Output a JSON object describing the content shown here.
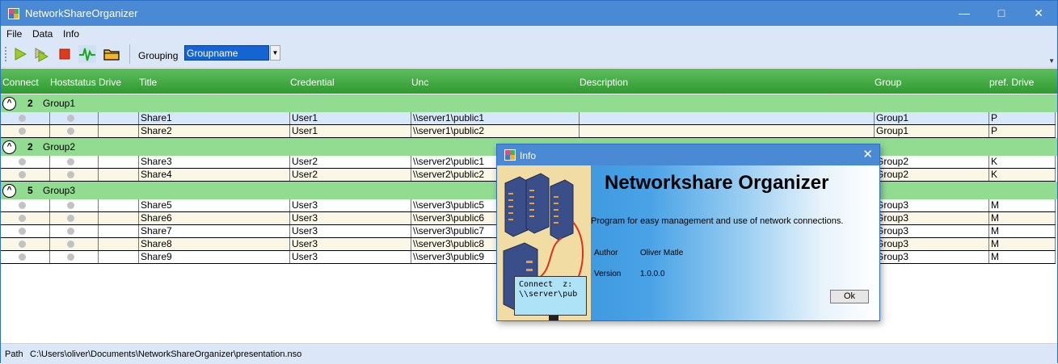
{
  "window": {
    "title": "NetworkShareOrganizer"
  },
  "menu": [
    "File",
    "Data",
    "Info"
  ],
  "toolbar": {
    "grouping_label": "Grouping",
    "grouping_value": "Groupname"
  },
  "columns": [
    "Connect",
    "Hoststatus",
    "Drive",
    "Title",
    "Credential",
    "Unc",
    "Description",
    "Group",
    "pref. Drive"
  ],
  "groups": [
    {
      "count": "2",
      "name": "Group1",
      "rows": [
        {
          "title": "Share1",
          "credential": "User1",
          "unc": "\\\\server1\\public1",
          "description": "",
          "group": "Group1",
          "pref_drive": "P"
        },
        {
          "title": "Share2",
          "credential": "User1",
          "unc": "\\\\server1\\public2",
          "description": "",
          "group": "Group1",
          "pref_drive": "P"
        }
      ]
    },
    {
      "count": "2",
      "name": "Group2",
      "rows": [
        {
          "title": "Share3",
          "credential": "User2",
          "unc": "\\\\server2\\public1",
          "description": "",
          "group": "Group2",
          "pref_drive": "K"
        },
        {
          "title": "Share4",
          "credential": "User2",
          "unc": "\\\\server2\\public2",
          "description": "",
          "group": "Group2",
          "pref_drive": "K"
        }
      ]
    },
    {
      "count": "5",
      "name": "Group3",
      "rows": [
        {
          "title": "Share5",
          "credential": "User3",
          "unc": "\\\\server3\\public5",
          "description": "",
          "group": "Group3",
          "pref_drive": "M"
        },
        {
          "title": "Share6",
          "credential": "User3",
          "unc": "\\\\server3\\public6",
          "description": "",
          "group": "Group3",
          "pref_drive": "M"
        },
        {
          "title": "Share7",
          "credential": "User3",
          "unc": "\\\\server3\\public7",
          "description": "",
          "group": "Group3",
          "pref_drive": "M"
        },
        {
          "title": "Share8",
          "credential": "User3",
          "unc": "\\\\server3\\public8",
          "description": "",
          "group": "Group3",
          "pref_drive": "M"
        },
        {
          "title": "Share9",
          "credential": "User3",
          "unc": "\\\\server3\\public9",
          "description": "",
          "group": "Group3",
          "pref_drive": "M"
        }
      ]
    }
  ],
  "status": {
    "path_label": "Path",
    "path_value": "C:\\Users\\oliver\\Documents\\NetworkShareOrganizer\\presentation.nso"
  },
  "dialog": {
    "title": "Info",
    "heading": "Networkshare Organizer",
    "description": "Program for easy management and use of network connections.",
    "author_label": "Author",
    "author_value": "Oliver Matle",
    "version_label": "Version",
    "version_value": "1.0.0.0",
    "ok_label": "Ok",
    "image_text": "Connect  z:\n\\\\server\\pub"
  },
  "icons": [
    "app-icon",
    "play-icon",
    "play-all-icon",
    "stop-icon",
    "pulse-icon",
    "folder-icon",
    "minimize-icon",
    "maximize-icon",
    "close-icon"
  ],
  "colors": {
    "title_bar": "#4a8ad4",
    "header_green": "#2e9a2e",
    "group_green": "#92dc92",
    "selection": "#1464d2"
  }
}
